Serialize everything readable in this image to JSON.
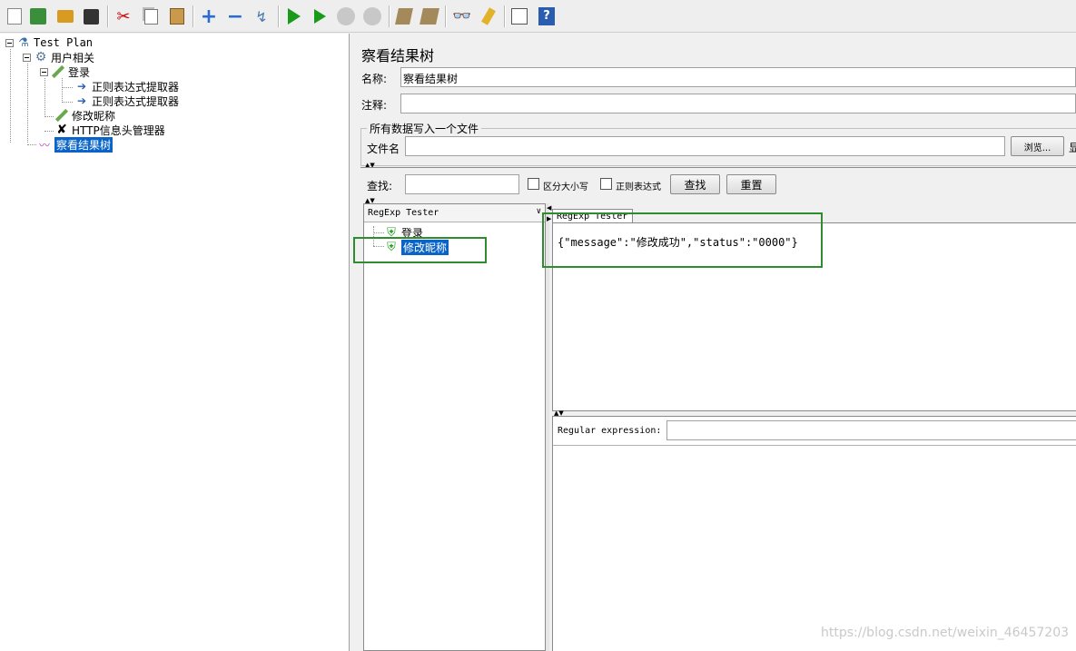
{
  "toolbar": {
    "icons": [
      "new-icon",
      "templates-icon",
      "open-icon",
      "save-icon",
      "cut-icon",
      "copy-icon",
      "paste-icon",
      "expand-icon",
      "collapse-icon",
      "toggle-icon",
      "start-icon",
      "start-no-pauses-icon",
      "stop-icon",
      "shutdown-icon",
      "clear-icon",
      "clear-all-icon",
      "search-icon",
      "reset-search-icon",
      "function-helper-icon",
      "help-icon"
    ]
  },
  "tree": {
    "items": [
      {
        "label": "Test Plan"
      },
      {
        "label": "用户相关"
      },
      {
        "label": "登录"
      },
      {
        "label": "正则表达式提取器"
      },
      {
        "label": "正则表达式提取器"
      },
      {
        "label": "修改昵称"
      },
      {
        "label": "HTTP信息头管理器"
      },
      {
        "label": "察看结果树"
      }
    ]
  },
  "panel": {
    "title": "察看结果树",
    "name_label": "名称:",
    "name_value": "察看结果树",
    "comment_label": "注释:",
    "comment_value": "",
    "file_group_title": "所有数据写入一个文件",
    "filename_label": "文件名",
    "filename_value": "",
    "browse_label": "浏览...",
    "cut_text": "显"
  },
  "search": {
    "label": "查找:",
    "value": "",
    "case_label": "区分大小写",
    "regex_label": "正则表达式",
    "find_button": "查找",
    "reset_button": "重置"
  },
  "results": {
    "renderer": "RegExp Tester",
    "items": [
      {
        "label": "登录"
      },
      {
        "label": "修改昵称"
      }
    ],
    "tab_label": "RegExp Tester",
    "response_text": "{\"message\":\"修改成功\",\"status\":\"0000\"}",
    "regex_label": "Regular expression:",
    "regex_value": ""
  },
  "watermark": "https://blog.csdn.net/weixin_46457203",
  "colors": {
    "selection": "#0a64c8",
    "highlight_box": "#2e8b2e"
  }
}
